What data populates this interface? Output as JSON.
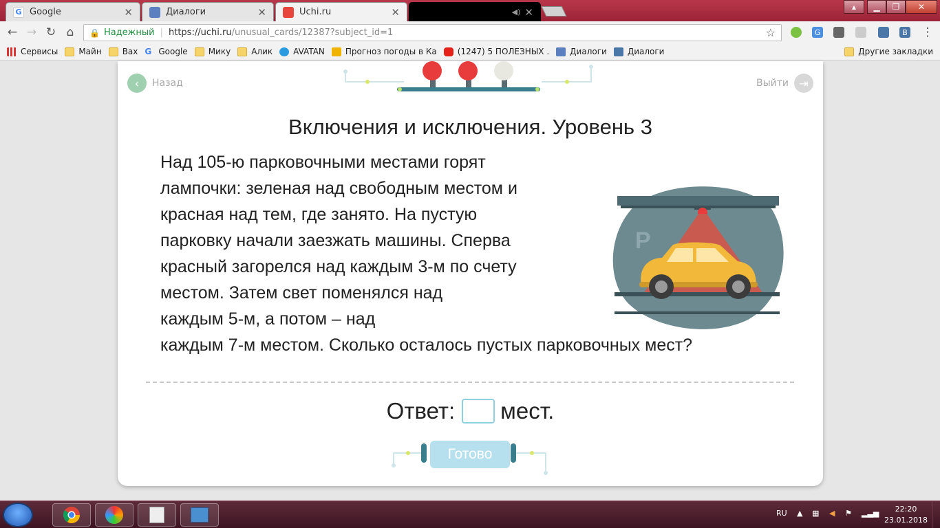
{
  "browser": {
    "tabs": [
      {
        "label": "Google",
        "icon_color": "#4285f4"
      },
      {
        "label": "Диалоги",
        "icon_color": "#5b7fbf"
      },
      {
        "label": "Uchi.ru",
        "icon_color": "#e8463c"
      }
    ],
    "security_label": "Надежный",
    "url_host": "https://uchi.ru",
    "url_path": "/unusual_cards/12387?subject_id=1",
    "bookmarks": [
      {
        "label": "Сервисы",
        "type": "apps"
      },
      {
        "label": "Майн",
        "type": "folder"
      },
      {
        "label": "Вах",
        "type": "folder"
      },
      {
        "label": "Google",
        "type": "google"
      },
      {
        "label": "Мику",
        "type": "folder"
      },
      {
        "label": "Алик",
        "type": "folder"
      },
      {
        "label": "AVATAN",
        "type": "avatan"
      },
      {
        "label": "Прогноз погоды в Ка",
        "type": "weather"
      },
      {
        "label": "(1247) 5 ПОЛЕЗНЫХ .",
        "type": "youtube"
      },
      {
        "label": "Диалоги",
        "type": "dialogs"
      },
      {
        "label": "Диалоги",
        "type": "vk"
      }
    ],
    "other_bookmarks": "Другие закладки"
  },
  "page": {
    "back_label": "Назад",
    "exit_label": "Выйти",
    "title": "Включения и исключения. Уровень 3",
    "problem_lines": [
      "Над 105-ю парковочными местами горят",
      "лампочки: зеленая над свободным местом и",
      "красная над тем, где занято. На пустую",
      "парковку начали заезжать машины. Сперва",
      "красный загорелся над каждым 3-м по счету",
      "местом. Затем свет поменялся над",
      "каждым 5-м, а потом – над",
      "каждым 7-м местом. Сколько осталось пустых парковочных мест?"
    ],
    "illustration_sign": "P",
    "answer_label": "Ответ:",
    "answer_value": "",
    "answer_unit": "мест.",
    "done_label": "Готово",
    "accent": "#9fd0b0",
    "done_color": "#b7e0ee"
  },
  "taskbar": {
    "language": "RU",
    "time": "22:20",
    "date": "23.01.2018"
  }
}
